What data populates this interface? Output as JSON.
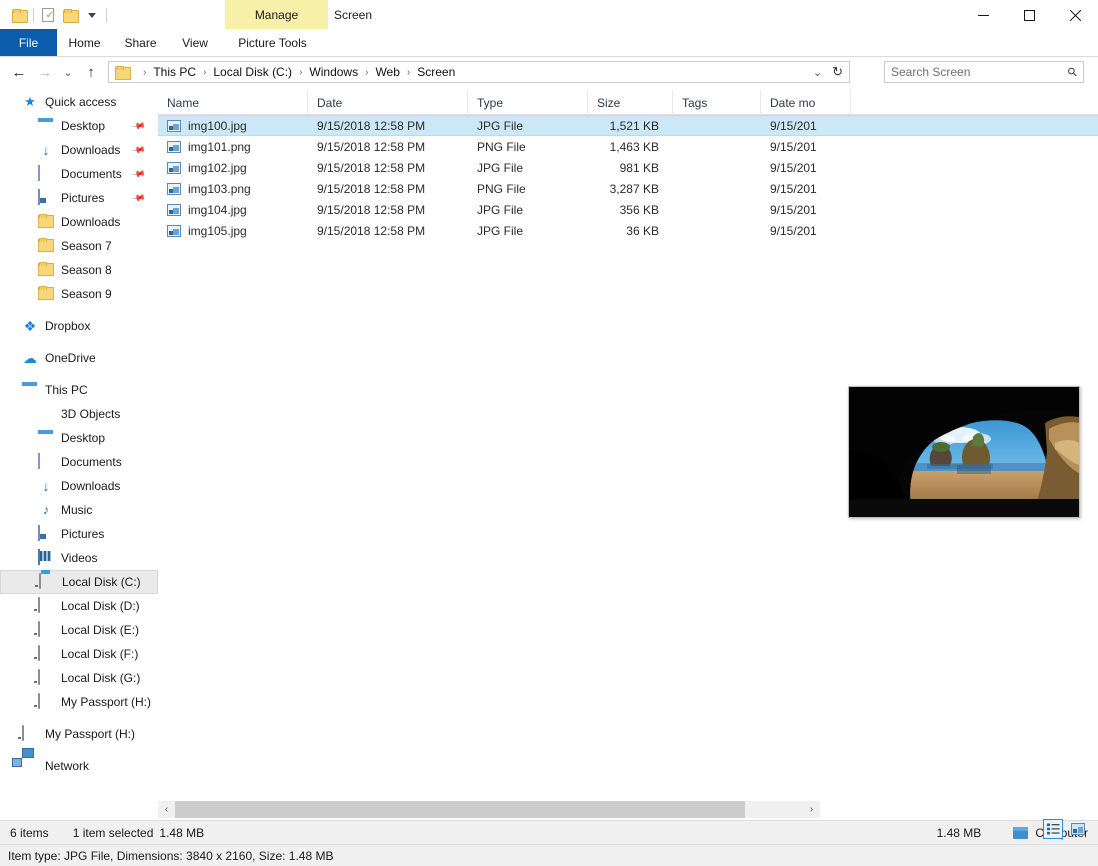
{
  "window": {
    "title": "Screen",
    "contextual_tab_header": "Manage",
    "minimize_label": "Minimize",
    "maximize_label": "Maximize",
    "close_label": "Close",
    "help_label": "?"
  },
  "quick_access_toolbar": {
    "items": [
      {
        "name": "properties-folder-icon",
        "label": "Properties"
      },
      {
        "name": "new-folder-icon",
        "label": "New folder"
      },
      {
        "name": "customize-folder-icon",
        "label": "Customize Quick Access Toolbar"
      }
    ]
  },
  "ribbon": {
    "tabs": [
      {
        "label": "File",
        "active": true
      },
      {
        "label": "Home",
        "active": false
      },
      {
        "label": "Share",
        "active": false
      },
      {
        "label": "View",
        "active": false
      },
      {
        "label": "Picture Tools",
        "active": false,
        "contextual": true
      }
    ]
  },
  "address": {
    "back_glyph": "←",
    "forward_glyph": "→",
    "recent_glyph": "⌄",
    "up_glyph": "↑",
    "breadcrumbs": [
      "This PC",
      "Local Disk (C:)",
      "Windows",
      "Web",
      "Screen"
    ],
    "separator": "›",
    "dropdown_glyph": "⌄",
    "refresh_glyph": "↻"
  },
  "search": {
    "placeholder": "Search Screen",
    "value": ""
  },
  "sidebar": {
    "groups": [
      {
        "items": [
          {
            "label": "Quick access",
            "icon": "star-icon",
            "indent": 0,
            "pinned": false,
            "selected": false
          },
          {
            "label": "Desktop",
            "icon": "desktop-icon",
            "indent": 1,
            "pinned": true,
            "selected": false
          },
          {
            "label": "Downloads",
            "icon": "downloads-icon",
            "indent": 1,
            "pinned": true,
            "selected": false
          },
          {
            "label": "Documents",
            "icon": "documents-icon",
            "indent": 1,
            "pinned": true,
            "selected": false
          },
          {
            "label": "Pictures",
            "icon": "pictures-icon",
            "indent": 1,
            "pinned": true,
            "selected": false
          },
          {
            "label": "Downloads",
            "icon": "folder-icon",
            "indent": 1,
            "pinned": false,
            "selected": false
          },
          {
            "label": "Season 7",
            "icon": "folder-icon",
            "indent": 1,
            "pinned": false,
            "selected": false
          },
          {
            "label": "Season 8",
            "icon": "folder-icon",
            "indent": 1,
            "pinned": false,
            "selected": false
          },
          {
            "label": "Season 9",
            "icon": "folder-icon",
            "indent": 1,
            "pinned": false,
            "selected": false
          }
        ]
      },
      {
        "items": [
          {
            "label": "Dropbox",
            "icon": "dropbox-icon",
            "indent": 0,
            "pinned": false,
            "selected": false
          }
        ]
      },
      {
        "items": [
          {
            "label": "OneDrive",
            "icon": "onedrive-cloud-icon",
            "indent": 0,
            "pinned": false,
            "selected": false
          }
        ]
      },
      {
        "items": [
          {
            "label": "This PC",
            "icon": "this-pc-icon",
            "indent": 0,
            "pinned": false,
            "selected": false
          },
          {
            "label": "3D Objects",
            "icon": "3d-objects-icon",
            "indent": 1,
            "pinned": false,
            "selected": false
          },
          {
            "label": "Desktop",
            "icon": "desktop-icon",
            "indent": 1,
            "pinned": false,
            "selected": false
          },
          {
            "label": "Documents",
            "icon": "documents-icon",
            "indent": 1,
            "pinned": false,
            "selected": false
          },
          {
            "label": "Downloads",
            "icon": "downloads-icon",
            "indent": 1,
            "pinned": false,
            "selected": false
          },
          {
            "label": "Music",
            "icon": "music-icon",
            "indent": 1,
            "pinned": false,
            "selected": false
          },
          {
            "label": "Pictures",
            "icon": "pictures-icon",
            "indent": 1,
            "pinned": false,
            "selected": false
          },
          {
            "label": "Videos",
            "icon": "videos-icon",
            "indent": 1,
            "pinned": false,
            "selected": false
          },
          {
            "label": "Local Disk (C:)",
            "icon": "system-drive-icon",
            "indent": 1,
            "pinned": false,
            "selected": true
          },
          {
            "label": "Local Disk (D:)",
            "icon": "drive-icon",
            "indent": 1,
            "pinned": false,
            "selected": false
          },
          {
            "label": "Local Disk (E:)",
            "icon": "drive-icon",
            "indent": 1,
            "pinned": false,
            "selected": false
          },
          {
            "label": "Local Disk (F:)",
            "icon": "drive-icon",
            "indent": 1,
            "pinned": false,
            "selected": false
          },
          {
            "label": "Local Disk (G:)",
            "icon": "drive-icon",
            "indent": 1,
            "pinned": false,
            "selected": false
          },
          {
            "label": "My Passport (H:)",
            "icon": "drive-icon",
            "indent": 1,
            "pinned": false,
            "selected": false
          }
        ]
      },
      {
        "items": [
          {
            "label": "My Passport (H:)",
            "icon": "drive-icon",
            "indent": 0,
            "pinned": false,
            "selected": false
          }
        ]
      },
      {
        "items": [
          {
            "label": "Network",
            "icon": "network-icon",
            "indent": 0,
            "pinned": false,
            "selected": false
          }
        ]
      }
    ]
  },
  "filelist": {
    "columns": [
      {
        "label": "Name",
        "width": 150,
        "align": "left"
      },
      {
        "label": "Date",
        "width": 160,
        "align": "left"
      },
      {
        "label": "Type",
        "width": 120,
        "align": "left"
      },
      {
        "label": "Size",
        "width": 85,
        "align": "right"
      },
      {
        "label": "Tags",
        "width": 88,
        "align": "left"
      },
      {
        "label": "Date mo",
        "width": 90,
        "align": "left"
      }
    ],
    "rows": [
      {
        "name": "img100.jpg",
        "date": "9/15/2018 12:58 PM",
        "type": "JPG File",
        "size": "1,521 KB",
        "tags": "",
        "date_modified": "9/15/201",
        "selected": true
      },
      {
        "name": "img101.png",
        "date": "9/15/2018 12:58 PM",
        "type": "PNG File",
        "size": "1,463 KB",
        "tags": "",
        "date_modified": "9/15/201",
        "selected": false
      },
      {
        "name": "img102.jpg",
        "date": "9/15/2018 12:58 PM",
        "type": "JPG File",
        "size": "981 KB",
        "tags": "",
        "date_modified": "9/15/201",
        "selected": false
      },
      {
        "name": "img103.png",
        "date": "9/15/2018 12:58 PM",
        "type": "PNG File",
        "size": "3,287 KB",
        "tags": "",
        "date_modified": "9/15/201",
        "selected": false
      },
      {
        "name": "img104.jpg",
        "date": "9/15/2018 12:58 PM",
        "type": "JPG File",
        "size": "356 KB",
        "tags": "",
        "date_modified": "9/15/201",
        "selected": false
      },
      {
        "name": "img105.jpg",
        "date": "9/15/2018 12:58 PM",
        "type": "JPG File",
        "size": "36 KB",
        "tags": "",
        "date_modified": "9/15/201",
        "selected": false
      }
    ]
  },
  "preview": {
    "alt": "Beach viewed through a dark sea cave with blue sky and rock formations"
  },
  "scrollbar": {
    "left_glyph": "‹",
    "right_glyph": "›"
  },
  "statusbar": {
    "item_count": "6 items",
    "selection": "1 item selected",
    "selection_size": "1.48 MB",
    "total_size": "1.48 MB",
    "location": "Computer",
    "view_details_label": "Details view",
    "view_large_icons_label": "Large icons view"
  },
  "detailsbar": {
    "text": "Item type: JPG File, Dimensions: 3840 x 2160, Size: 1.48 MB"
  },
  "colors": {
    "accent": "#0b5cab",
    "contextual_tab": "#f6f0a8",
    "selection": "#cbe8f6",
    "sidebar_selection": "#eaeaea",
    "statusbar": "#f0f0f0"
  }
}
